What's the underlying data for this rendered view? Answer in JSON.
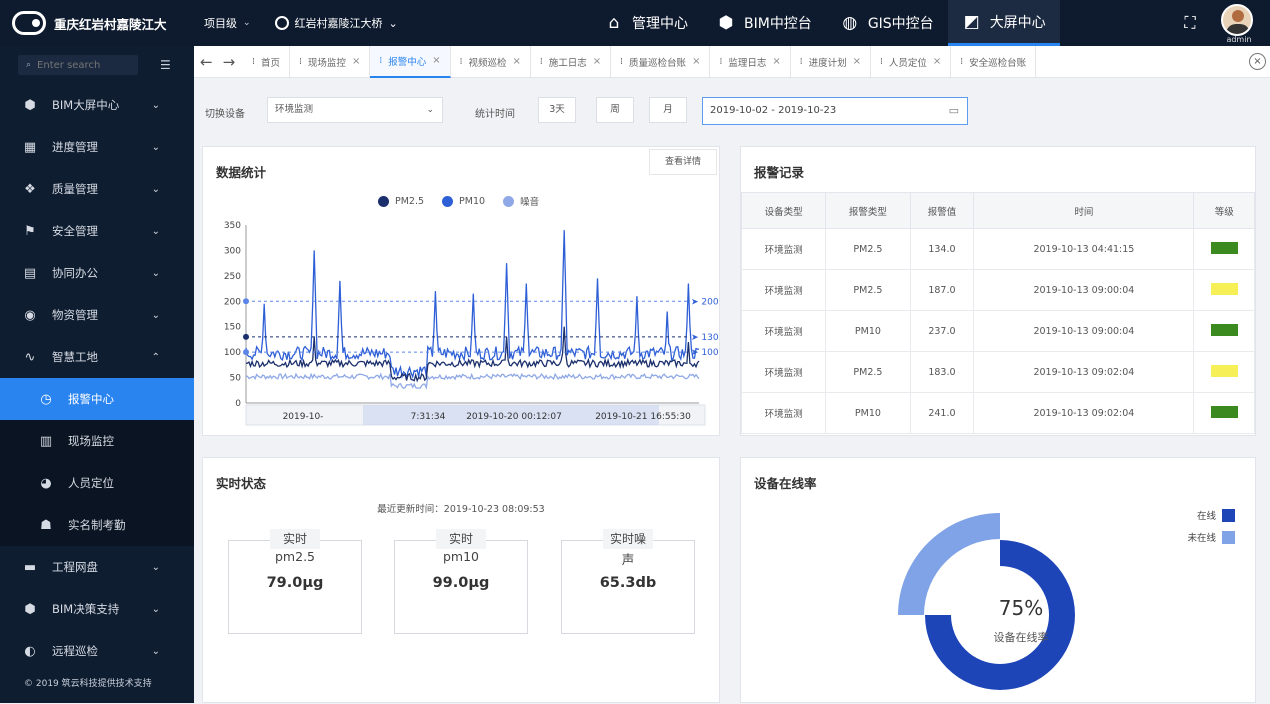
{
  "header": {
    "title": "重庆红岩村嘉陵江大",
    "project_label": "项目级",
    "project_name": "红岩村嘉陵江大桥",
    "navs": [
      {
        "label": "管理中心",
        "icon": "home-icon"
      },
      {
        "label": "BIM中控台",
        "icon": "cube-icon"
      },
      {
        "label": "GIS中控台",
        "icon": "globe-icon"
      },
      {
        "label": "大屏中心",
        "icon": "chart-icon"
      }
    ],
    "user": "admin"
  },
  "sidebar": {
    "search_placeholder": "Enter search",
    "items": [
      {
        "label": "BIM大屏中心",
        "icon": "cube-icon"
      },
      {
        "label": "进度管理",
        "icon": "grid-icon"
      },
      {
        "label": "质量管理",
        "icon": "quality-icon"
      },
      {
        "label": "安全管理",
        "icon": "flag-icon"
      },
      {
        "label": "协同办公",
        "icon": "document-icon"
      },
      {
        "label": "物资管理",
        "icon": "materials-icon"
      },
      {
        "label": "智慧工地",
        "icon": "pulse-icon"
      }
    ],
    "sub_items": [
      {
        "label": "报警中心",
        "icon": "alarm-icon"
      },
      {
        "label": "现场监控",
        "icon": "building-icon"
      },
      {
        "label": "人员定位",
        "icon": "person-icon"
      },
      {
        "label": "实名制考勤",
        "icon": "group-icon"
      }
    ],
    "bottom_items": [
      {
        "label": "工程网盘",
        "icon": "folder-icon"
      },
      {
        "label": "BIM决策支持",
        "icon": "cube-icon"
      },
      {
        "label": "远程巡检",
        "icon": "half-circle-icon"
      }
    ],
    "copyright": "© 2019 筑云科技提供技术支持"
  },
  "tabs": [
    "首页",
    "现场监控",
    "报警中心",
    "视频巡检",
    "施工日志",
    "质量巡检台账",
    "监理日志",
    "进度计划",
    "人员定位",
    "安全巡检台账"
  ],
  "filters": {
    "device_label": "切换设备",
    "device_value": "环境监测",
    "time_label": "统计时间",
    "btn_3d": "3天",
    "btn_week": "周",
    "btn_month": "月",
    "date_range": "2019-10-02 - 2019-10-23"
  },
  "stats_panel": {
    "title": "数据统计",
    "detail_btn": "查看详情"
  },
  "chart_data": {
    "type": "line",
    "title": "数据统计",
    "series": [
      {
        "name": "PM2.5",
        "color": "#1a2f6b"
      },
      {
        "name": "PM10",
        "color": "#2f5fd6"
      },
      {
        "name": "噪音",
        "color": "#8fa9e6"
      }
    ],
    "x_ticks": [
      "2019-10-",
      "7:31:34",
      "2019-10-20 00:12:07",
      "2019-10-21 16:55:30"
    ],
    "ylim": [
      0,
      350
    ],
    "y_ticks": [
      0,
      50,
      100,
      150,
      200,
      250,
      300,
      350
    ],
    "mark_lines": [
      {
        "label": "200",
        "value": 200
      },
      {
        "label": "130",
        "value": 130
      },
      {
        "label": "100",
        "value": 100
      }
    ]
  },
  "alarm_panel": {
    "title": "报警记录",
    "columns": [
      "设备类型",
      "报警类型",
      "报警值",
      "时间",
      "等级"
    ],
    "rows": [
      {
        "device": "环境监测",
        "type": "PM2.5",
        "value": "134.0",
        "time": "2019-10-13 04:41:15",
        "level_color": "#3a8a1f"
      },
      {
        "device": "环境监测",
        "type": "PM2.5",
        "value": "187.0",
        "time": "2019-10-13 09:00:04",
        "level_color": "#f7ef56"
      },
      {
        "device": "环境监测",
        "type": "PM10",
        "value": "237.0",
        "time": "2019-10-13 09:00:04",
        "level_color": "#3a8a1f"
      },
      {
        "device": "环境监测",
        "type": "PM2.5",
        "value": "183.0",
        "time": "2019-10-13 09:02:04",
        "level_color": "#f7ef56"
      },
      {
        "device": "环境监测",
        "type": "PM10",
        "value": "241.0",
        "time": "2019-10-13 09:02:04",
        "level_color": "#3a8a1f"
      }
    ]
  },
  "realtime_panel": {
    "title": "实时状态",
    "updated": "最近更新时间：2019-10-23 08:09:53",
    "boxes": [
      {
        "cap": "实时",
        "sub": "pm2.5",
        "value": "79.0μg"
      },
      {
        "cap": "实时",
        "sub": "pm10",
        "value": "99.0μg"
      },
      {
        "cap": "实时噪",
        "sub": "声",
        "value": "65.3db"
      }
    ]
  },
  "online_panel": {
    "title": "设备在线率",
    "legend": [
      {
        "label": "在线",
        "color": "#1d45b8"
      },
      {
        "label": "未在线",
        "color": "#7fa3e6"
      }
    ],
    "online_ratio": 0.75,
    "center_value": "75%",
    "center_label": "设备在线率"
  }
}
